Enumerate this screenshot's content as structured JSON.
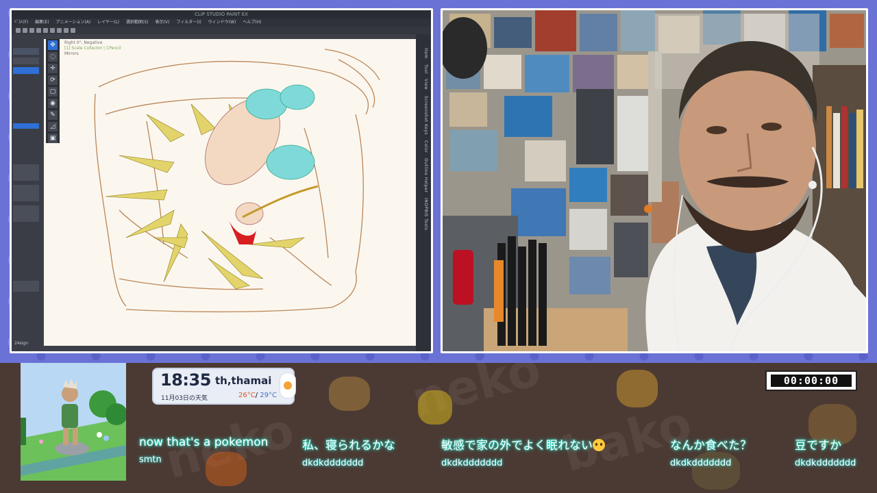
{
  "art_app": {
    "title": "CLIP STUDIO PAINT EX",
    "menu": [
      "ﾍﾞｽﾄ(F)",
      "編集(E)",
      "アニメーション(A)",
      "レイヤー(L)",
      "選択範囲(S)",
      "表示(V)",
      "フィルター(I)",
      "ウィンドウ(W)",
      "ヘルプ(H)"
    ],
    "canvas_info": [
      "Right 0°, Negative",
      "[1] Scale Collector | CPencil",
      "Mirrors"
    ],
    "dock_tabs": [
      "Item",
      "Tool",
      "View",
      "Screenshot Keys",
      "Color",
      "Outline Helper",
      "INOPBIS Tools"
    ],
    "zoom_label": "24sign"
  },
  "clock": {
    "time": "18:35",
    "username": "th,thamai",
    "date_weather": "11月03日の天気",
    "temp_high": "26°C",
    "temp_sep": "/",
    "temp_low": "29°C"
  },
  "timer": {
    "display": "00:00:00"
  },
  "chat": [
    {
      "message": "now that's a pokemon",
      "user": "smtn"
    },
    {
      "message": "私、寝られるかな",
      "user": "dkdkddddddd"
    },
    {
      "message": "敏感で家の外でよく眠れない",
      "user": "dkdkddddddd",
      "emoji": "crying-face"
    },
    {
      "message": "なんか食べた？",
      "user": "dkdkddddddd"
    },
    {
      "message": "豆ですか",
      "user": "dkdkddddddd"
    }
  ],
  "colors": {
    "background": "#6b72d6",
    "bottom_bar": "#4b3a33",
    "chat_glow": "#3ff2e6",
    "temp_high": "#d85a2c",
    "temp_low": "#3d72c7"
  }
}
